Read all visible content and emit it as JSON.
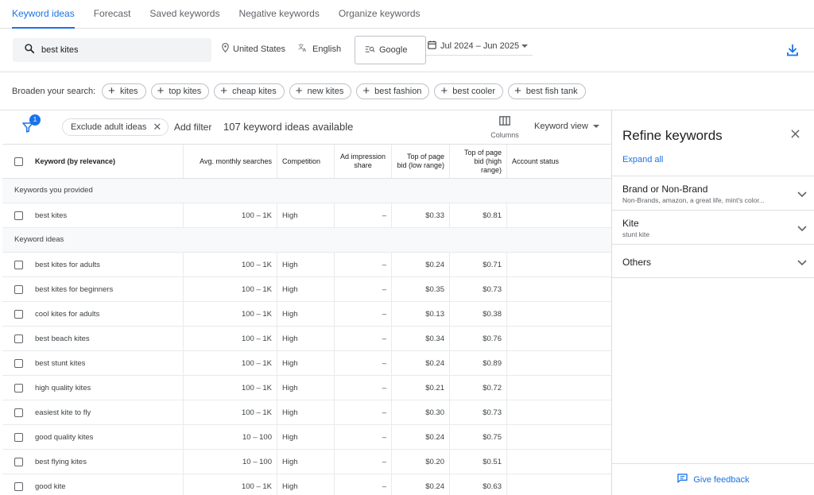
{
  "tabs": [
    {
      "label": "Keyword ideas"
    },
    {
      "label": "Forecast"
    },
    {
      "label": "Saved keywords"
    },
    {
      "label": "Negative keywords"
    },
    {
      "label": "Organize keywords"
    }
  ],
  "search": {
    "value": "best kites"
  },
  "location": "United States",
  "language": "English",
  "network": "Google",
  "date_range": "Jul 2024 – Jun 2025",
  "broaden": {
    "label": "Broaden your search:",
    "chips": [
      "kites",
      "top kites",
      "cheap kites",
      "new kites",
      "best fashion",
      "best cooler",
      "best fish tank"
    ]
  },
  "toolbar": {
    "filter_badge": "1",
    "exclude_chip": "Exclude adult ideas",
    "add_filter": "Add filter",
    "count_text": "107 keyword ideas available",
    "columns_label": "Columns",
    "view_label": "Keyword view"
  },
  "table": {
    "headers": [
      "Keyword (by relevance)",
      "Avg. monthly searches",
      "Competition",
      "Ad impression share",
      "Top of page bid (low range)",
      "Top of page bid (high range)",
      "Account status"
    ],
    "section_provided": "Keywords you provided",
    "provided_rows": [
      {
        "kw": "best kites",
        "avg": "100 – 1K",
        "comp": "High",
        "share": "–",
        "low": "$0.33",
        "high": "$0.81"
      }
    ],
    "section_ideas": "Keyword ideas",
    "idea_rows": [
      {
        "kw": "best kites for adults",
        "avg": "100 – 1K",
        "comp": "High",
        "share": "–",
        "low": "$0.24",
        "high": "$0.71"
      },
      {
        "kw": "best kites for beginners",
        "avg": "100 – 1K",
        "comp": "High",
        "share": "–",
        "low": "$0.35",
        "high": "$0.73"
      },
      {
        "kw": "cool kites for adults",
        "avg": "100 – 1K",
        "comp": "High",
        "share": "–",
        "low": "$0.13",
        "high": "$0.38"
      },
      {
        "kw": "best beach kites",
        "avg": "100 – 1K",
        "comp": "High",
        "share": "–",
        "low": "$0.34",
        "high": "$0.76"
      },
      {
        "kw": "best stunt kites",
        "avg": "100 – 1K",
        "comp": "High",
        "share": "–",
        "low": "$0.24",
        "high": "$0.89"
      },
      {
        "kw": "high quality kites",
        "avg": "100 – 1K",
        "comp": "High",
        "share": "–",
        "low": "$0.21",
        "high": "$0.72"
      },
      {
        "kw": "easiest kite to fly",
        "avg": "100 – 1K",
        "comp": "High",
        "share": "–",
        "low": "$0.30",
        "high": "$0.73"
      },
      {
        "kw": "good quality kites",
        "avg": "10 – 100",
        "comp": "High",
        "share": "–",
        "low": "$0.24",
        "high": "$0.75"
      },
      {
        "kw": "best flying kites",
        "avg": "10 – 100",
        "comp": "High",
        "share": "–",
        "low": "$0.20",
        "high": "$0.51"
      },
      {
        "kw": "good kite",
        "avg": "100 – 1K",
        "comp": "High",
        "share": "–",
        "low": "$0.24",
        "high": "$0.63"
      }
    ]
  },
  "refine": {
    "title": "Refine keywords",
    "expand_all": "Expand all",
    "groups": [
      {
        "title": "Brand or Non-Brand",
        "subtitle": "Non-Brands, amazon, a great life, mint's color..."
      },
      {
        "title": "Kite",
        "subtitle": "stunt kite"
      },
      {
        "title": "Others",
        "subtitle": ""
      }
    ],
    "feedback": "Give feedback"
  },
  "colors": {
    "accent": "#1a73e8",
    "border": "#e0e0e0",
    "section_bg": "#f8f9fa"
  },
  "icons": [
    "search-icon",
    "location-pin-icon",
    "translate-icon",
    "network-search-icon",
    "calendar-icon",
    "download-icon",
    "funnel-icon",
    "columns-icon",
    "close-icon",
    "chevron-down-icon",
    "feedback-icon"
  ]
}
